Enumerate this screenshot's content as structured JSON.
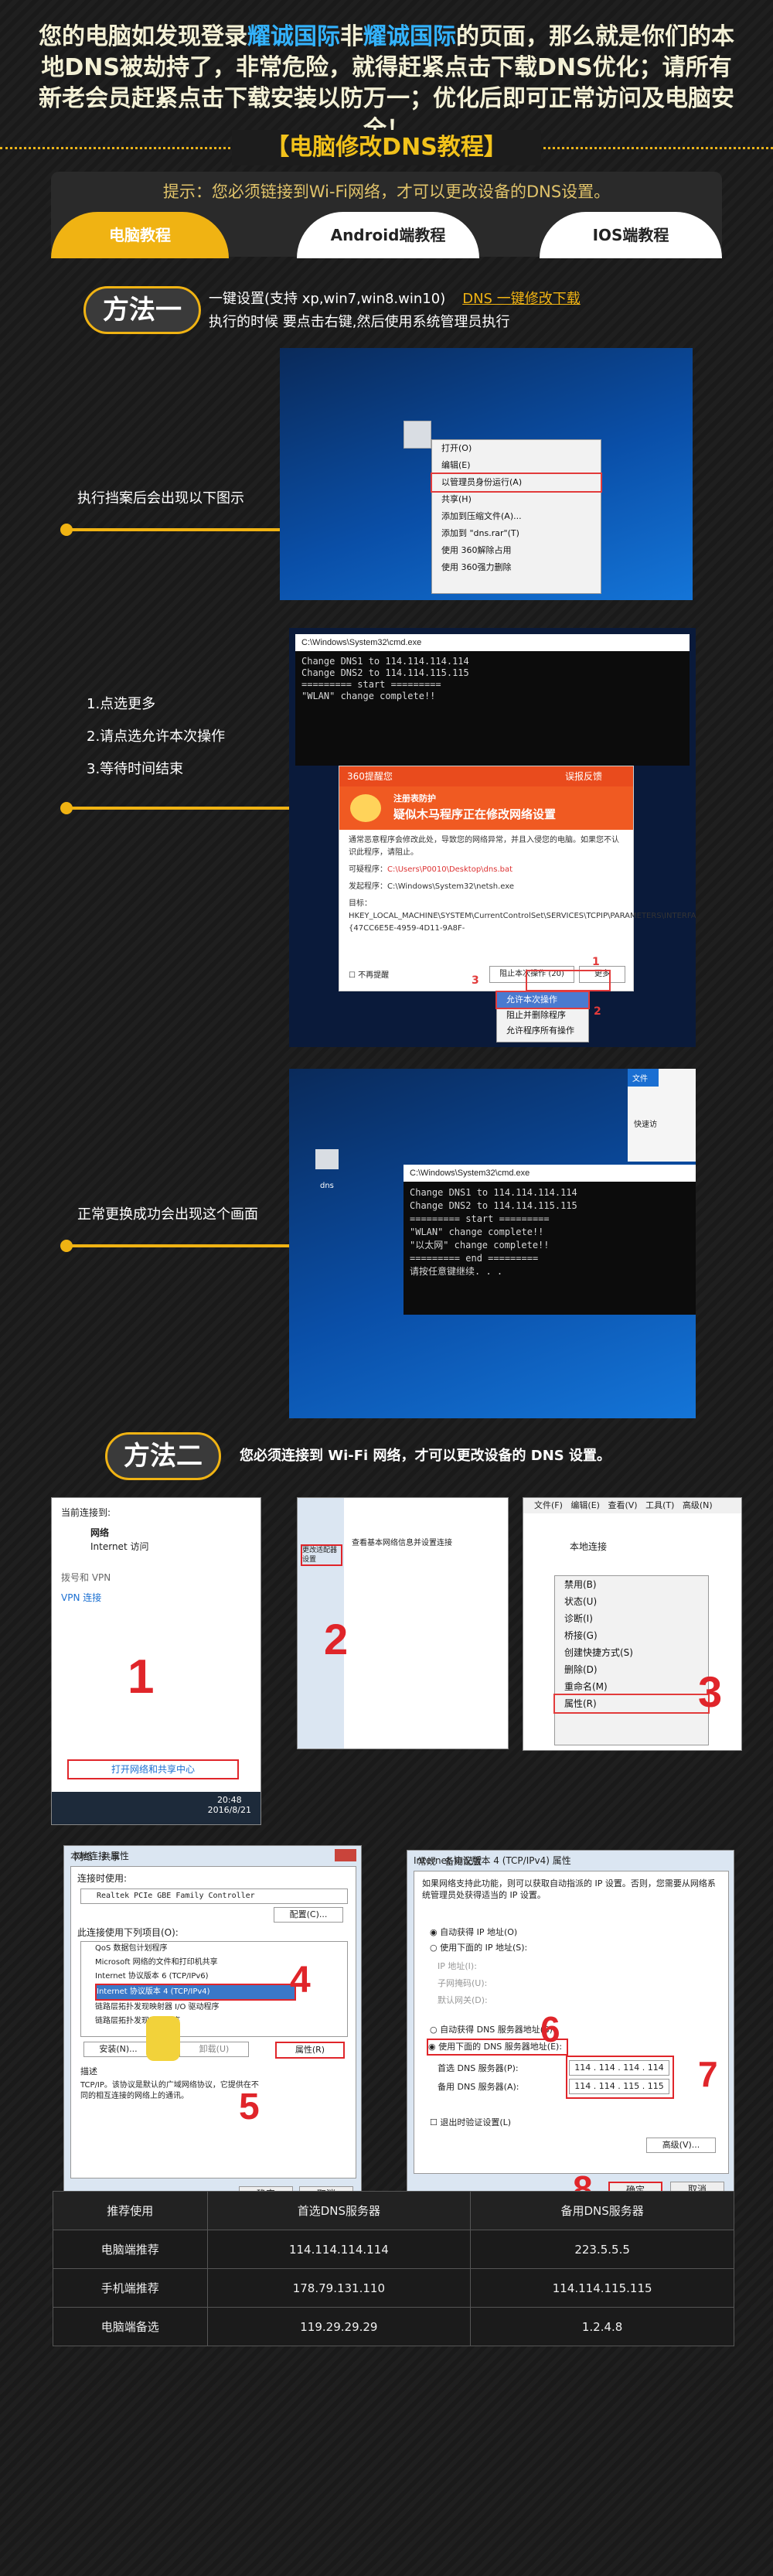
{
  "warning": {
    "part1": "您的电脑如发现登录",
    "brand1": "耀诚国际",
    "part2": "非",
    "brand2": "耀诚国际",
    "part3": "的页面，那么就是你们的本地DNS被劫持了，非常危险，就得赶紧点击下载DNS优化；请所有新老会员赶紧点击下载安装以防万一；优化后即可正常访问及电脑安全！"
  },
  "tutorial_title": "【电脑修改DNS教程】",
  "tip": "提示：您必须链接到Wi-Fi网络，才可以更改设备的DNS设置。",
  "tabs": [
    {
      "label": "电脑教程"
    },
    {
      "label": "Android端教程"
    },
    {
      "label": "IOS端教程"
    }
  ],
  "method1": {
    "title": "方法一",
    "line1": "一键设置(支持 xp,win7,win8.win10)",
    "link": "DNS 一键修改下载",
    "line2": "执行的时候 要点击右键,然后使用系统管理员执行"
  },
  "step1_label": "执行挡案后会出现以下图示",
  "step2_labels": [
    "1.点选更多",
    "2.请点选允许本次操作",
    "3.等待时间结束"
  ],
  "step3_label": "正常更换成功会出现这个画面",
  "context_menu": {
    "items": [
      "打开(O)",
      "编辑(E)",
      "以管理员身份运行(A)",
      "共享(H)",
      "添加到压缩文件(A)...",
      "添加到 \"dns.rar\"(T)",
      "使用 360解除占用",
      "使用 360强力删除"
    ]
  },
  "desktop_icon_label": "dns",
  "cmd1": {
    "title": "C:\\Windows\\System32\\cmd.exe",
    "lines": [
      "Change DNS1 to 114.114.114.114",
      "Change DNS2 to 114.114.115.115",
      "========= start =========",
      "\"WLAN\" change complete!!"
    ]
  },
  "dialog": {
    "header": "360提醒您",
    "header_right": "误报反馈",
    "banner_title": "注册表防护",
    "banner_sub": "疑似木马程序正在修改网络设置",
    "text1": "通常恶意程序会修改此处，导致您的网络异常，并且入侵您的电脑。如果您不认识此程序，请阻止。",
    "program_label": "可疑程序：",
    "program_path": "C:\\Users\\P0010\\Desktop\\dns.bat",
    "parent_label": "发起程序：",
    "parent_path": "C:\\Windows\\System32\\netsh.exe",
    "target_label": "目标：",
    "target_path": "HKEY_LOCAL_MACHINE\\SYSTEM\\CurrentControlSet\\SERVICES\\TCPIP\\PARAMETERS\\INTERFACES\\{47CC6E5E-4959-4D11-9A8F-",
    "checkbox": "不再提醒",
    "block_button": "阻止本次操作 (20)",
    "more_button": "更多",
    "menu_items": [
      "允许本次操作",
      "阻止并删除程序",
      "允许程序所有操作"
    ],
    "marks": [
      "1",
      "2",
      "3"
    ]
  },
  "cmd2": {
    "title": "C:\\Windows\\System32\\cmd.exe",
    "lines": [
      "Change DNS1 to 114.114.114.114",
      "Change DNS2 to 114.114.115.115",
      "========= start =========",
      "\"WLAN\" change complete!!",
      "\"以太网\" change complete!!",
      "========= end =========",
      "请按任意键继续. . ."
    ],
    "explorer_tab": "文件",
    "explorer_item": "快速访"
  },
  "method2": {
    "title": "方法二",
    "desc": "您必须连接到 Wi-Fi 网络，才可以更改设备的 DNS 设置。"
  },
  "shot1": {
    "connected_label": "当前连接到:",
    "network": "网络",
    "access": "Internet 访问",
    "dialup": "拨号和 VPN",
    "vpn": "VPN 连接",
    "link": "打开网络和共享中心",
    "time": "20:48",
    "date": "2016/8/21",
    "num": "1"
  },
  "shot2": {
    "num": "2",
    "heading": "查看基本网络信息并设置连接",
    "link": "更改适配器设置"
  },
  "shot3": {
    "menu": [
      "文件(F)",
      "编辑(E)",
      "查看(V)",
      "工具(T)",
      "高级(N)"
    ],
    "adapter": "本地连接",
    "items": [
      "禁用(B)",
      "状态(U)",
      "诊断(I)",
      "桥接(G)",
      "创建快捷方式(S)",
      "删除(D)",
      "重命名(M)",
      "属性(R)"
    ],
    "num": "3"
  },
  "shot4": {
    "title": "本地连接 属性",
    "tabs": [
      "网络",
      "共享"
    ],
    "connect_using": "连接时使用:",
    "adapter": "Realtek PCIe GBE Family Controller",
    "configure": "配置(C)...",
    "items_label": "此连接使用下列项目(O):",
    "items": [
      "QoS 数据包计划程序",
      "Microsoft 网络的文件和打印机共享",
      "Internet 协议版本 6 (TCP/IPv6)",
      "Internet 协议版本 4 (TCP/IPv4)",
      "链路层拓扑发现映射器 I/O 驱动程序",
      "链路层拓扑发现响应程序"
    ],
    "install": "安装(N)...",
    "uninstall": "卸载(U)",
    "properties": "属性(R)",
    "desc_label": "描述",
    "desc": "TCP/IP。该协议是默认的广域网络协议，它提供在不同的相互连接的网络上的通讯。",
    "ok": "确定",
    "cancel": "取消",
    "nums": [
      "4",
      "5"
    ]
  },
  "shot5": {
    "title": "Internet 协议版本 4 (TCP/IPv4) 属性",
    "tabs": [
      "常规",
      "备用配置"
    ],
    "intro": "如果网络支持此功能，则可以获取自动指派的 IP 设置。否则，您需要从网络系统管理员处获得适当的 IP 设置。",
    "auto_ip": "自动获得 IP 地址(O)",
    "manual_ip": "使用下面的 IP 地址(S):",
    "ip": "IP 地址(I):",
    "mask": "子网掩码(U):",
    "gateway": "默认网关(D):",
    "auto_dns": "自动获得 DNS 服务器地址(B)",
    "manual_dns": "使用下面的 DNS 服务器地址(E):",
    "pref_dns_label": "首选 DNS 服务器(P):",
    "pref_dns": "114 . 114 . 114 . 114",
    "alt_dns_label": "备用 DNS 服务器(A):",
    "alt_dns": "114 . 114 . 115 . 115",
    "validate": "退出时验证设置(L)",
    "advanced": "高级(V)...",
    "ok": "确定",
    "cancel": "取消",
    "nums": [
      "6",
      "7",
      "8"
    ]
  },
  "dns_table": {
    "headers": [
      "推荐使用",
      "首选DNS服务器",
      "备用DNS服务器"
    ],
    "rows": [
      [
        "电脑端推荐",
        "114.114.114.114",
        "223.5.5.5"
      ],
      [
        "手机端推荐",
        "178.79.131.110",
        "114.114.115.115"
      ],
      [
        "电脑端备选",
        "119.29.29.29",
        "1.2.4.8"
      ]
    ]
  }
}
